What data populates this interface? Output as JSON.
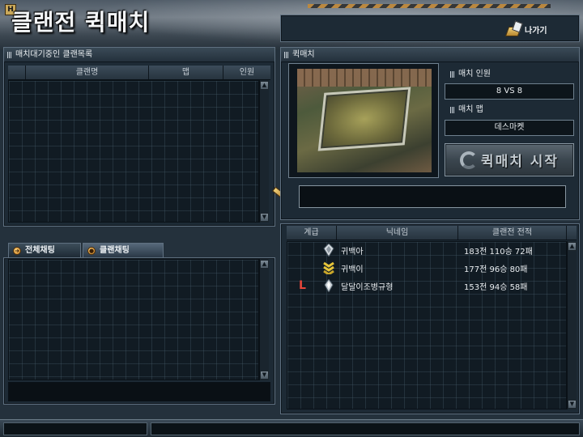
{
  "header": {
    "title": "클랜전 퀵매치",
    "badge": "H",
    "exit_label": "나가기"
  },
  "waiting_list": {
    "title": "매치대기중인 클랜목록",
    "columns": [
      "클랜명",
      "맵",
      "인원"
    ],
    "rows": []
  },
  "chat_tabs": [
    {
      "label": "전체채팅",
      "active": false
    },
    {
      "label": "클랜채팅",
      "active": true
    }
  ],
  "quickmatch": {
    "title": "퀵매치",
    "map_preview_icon": "deathmarket-map-thumbnail",
    "match_players_label": "매치 인원",
    "match_players_value": "8 VS 8",
    "match_map_label": "매치 맵",
    "match_map_value": "데스마켓",
    "start_label": "퀵매치 시작"
  },
  "members": {
    "columns": [
      "계급",
      "닉네임",
      "클랜전 전적"
    ],
    "rows": [
      {
        "leader": "",
        "rank_icon": "diamond-rank-icon",
        "nickname": "귀백아",
        "record": "183전 110승 72패"
      },
      {
        "leader": "",
        "rank_icon": "gold-chevron-rank-icon",
        "nickname": "귀백이",
        "record": "177전 96승 80패"
      },
      {
        "leader": "L",
        "rank_icon": "diamond-rank-icon",
        "nickname": "달달이조병규형",
        "record": "153전 94승 58패"
      }
    ]
  },
  "colors": {
    "panel_bg": "#1d2a35",
    "border": "#5f7080",
    "leader_mark": "#e6453a",
    "accent_gold": "#c78a33"
  }
}
